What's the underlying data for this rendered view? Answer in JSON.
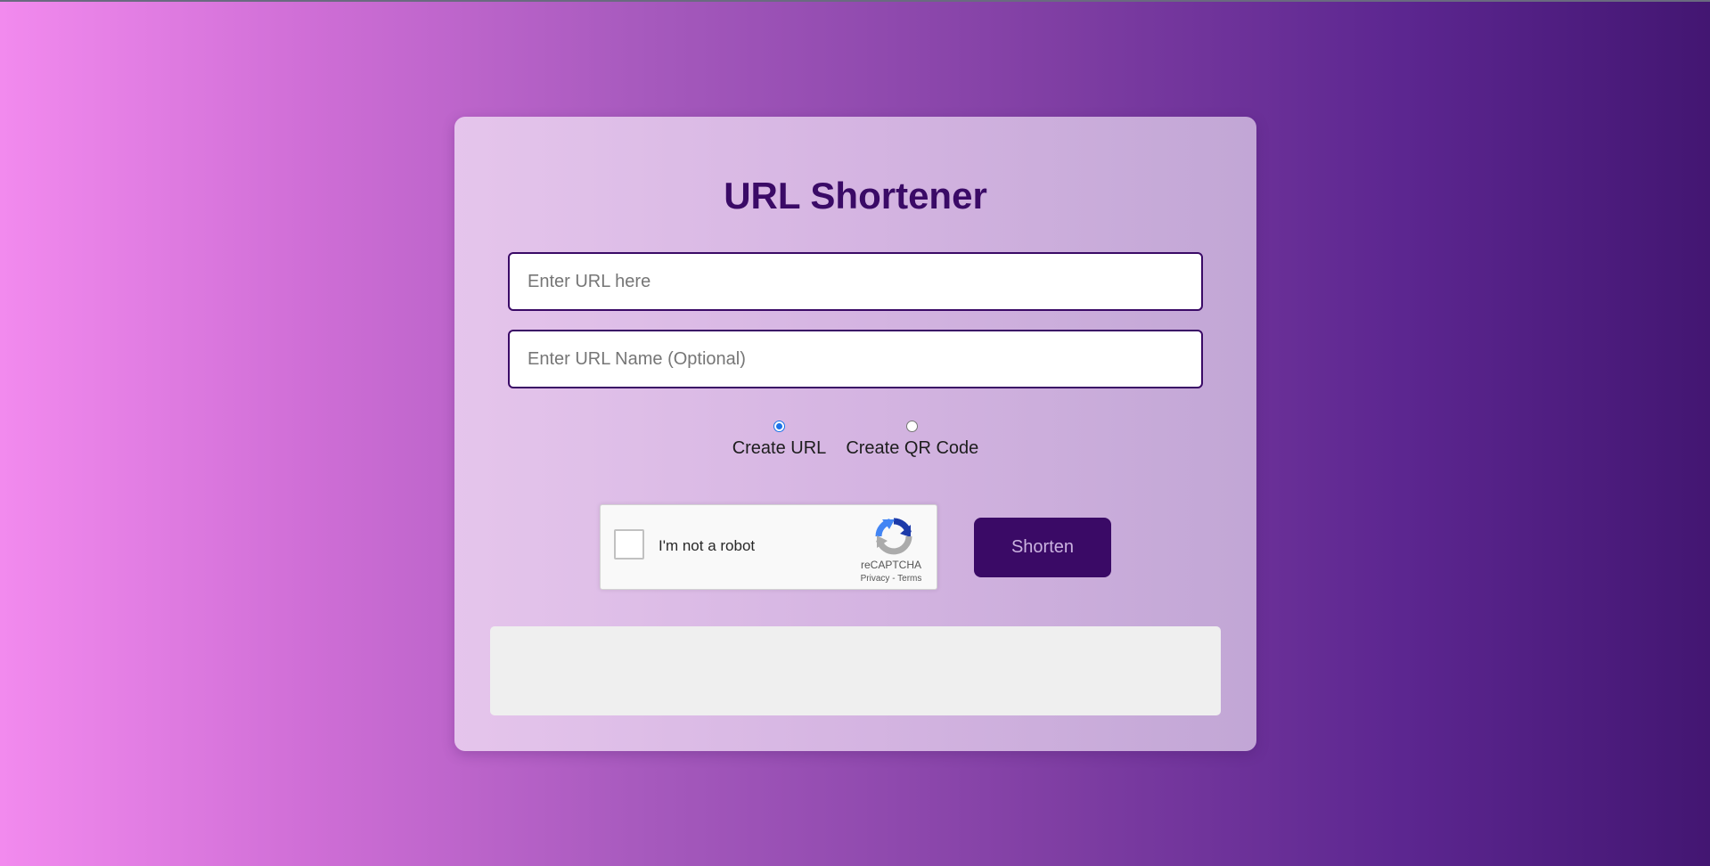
{
  "page": {
    "title": "URL Shortener"
  },
  "form": {
    "url_input": {
      "value": "",
      "placeholder": "Enter URL here"
    },
    "name_input": {
      "value": "",
      "placeholder": "Enter URL Name (Optional)"
    },
    "mode_options": [
      {
        "label": "Create URL",
        "selected": true
      },
      {
        "label": "Create QR Code",
        "selected": false
      }
    ],
    "submit_label": "Shorten"
  },
  "recaptcha": {
    "label": "I'm not a robot",
    "brand": "reCAPTCHA",
    "privacy": "Privacy",
    "separator": " - ",
    "terms": "Terms",
    "checked": false
  },
  "result": {
    "text": ""
  },
  "colors": {
    "accent": "#3a0a66",
    "radio_selected": "#1a73e8",
    "result_background": "#efefef",
    "gradient_start": "#f28aee",
    "gradient_end": "#431672"
  },
  "icons": {
    "recaptcha": "recaptcha-logo-icon"
  }
}
